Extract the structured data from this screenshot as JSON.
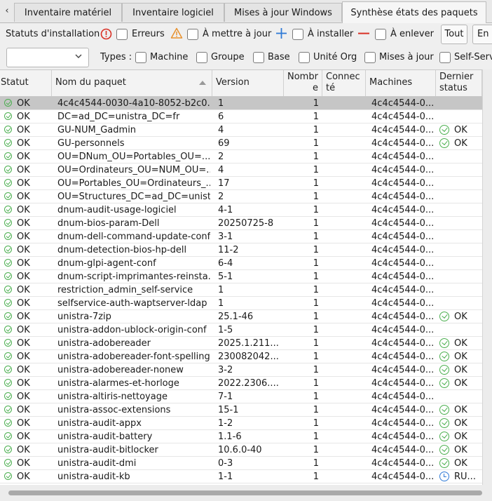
{
  "tabs": [
    {
      "label": "Inventaire matériel",
      "active": false
    },
    {
      "label": "Inventaire logiciel",
      "active": false
    },
    {
      "label": "Mises à jour Windows",
      "active": false
    },
    {
      "label": "Synthèse états des paquets",
      "active": true
    }
  ],
  "filters": {
    "status_label": "Statuts d'installation",
    "errors": "Erreurs",
    "to_update": "À mettre à jour",
    "to_install": "À installer",
    "to_remove": "À enlever",
    "all_button": "Tout",
    "cut_button": "En a",
    "types_label": "Types :",
    "types": [
      "Machine",
      "Groupe",
      "Base",
      "Unité Org",
      "Mises à jour",
      "Self-Serv"
    ],
    "combo_value": ""
  },
  "columns": {
    "status": "Statut",
    "package": "Nom du paquet",
    "version": "Version",
    "count_1": "Nombr",
    "count_2": "e",
    "connected_1": "Connec",
    "connected_2": "té",
    "machines": "Machines",
    "last_1": "Dernier",
    "last_2": "status"
  },
  "rows": [
    {
      "status": "OK",
      "name": "4c4c4544-0030-4a10-8052-b2c0...",
      "version": "1",
      "count": "1",
      "machines": "4c4c4544-0...",
      "last": ""
    },
    {
      "status": "OK",
      "name": "DC=ad_DC=unistra_DC=fr",
      "version": "6",
      "count": "1",
      "machines": "4c4c4544-0...",
      "last": ""
    },
    {
      "status": "OK",
      "name": "GU-NUM_Gadmin",
      "version": "4",
      "count": "1",
      "machines": "4c4c4544-0...",
      "last": "OK"
    },
    {
      "status": "OK",
      "name": "GU-personnels",
      "version": "69",
      "count": "1",
      "machines": "4c4c4544-0...",
      "last": "OK"
    },
    {
      "status": "OK",
      "name": "OU=DNum_OU=Portables_OU=...",
      "version": "2",
      "count": "1",
      "machines": "4c4c4544-0...",
      "last": ""
    },
    {
      "status": "OK",
      "name": "OU=Ordinateurs_OU=NUM_OU=...",
      "version": "4",
      "count": "1",
      "machines": "4c4c4544-0...",
      "last": ""
    },
    {
      "status": "OK",
      "name": "OU=Portables_OU=Ordinateurs_...",
      "version": "17",
      "count": "1",
      "machines": "4c4c4544-0...",
      "last": ""
    },
    {
      "status": "OK",
      "name": "OU=Structures_DC=ad_DC=unist...",
      "version": "2",
      "count": "1",
      "machines": "4c4c4544-0...",
      "last": ""
    },
    {
      "status": "OK",
      "name": "dnum-audit-usage-logiciel",
      "version": "4-1",
      "count": "1",
      "machines": "4c4c4544-0...",
      "last": ""
    },
    {
      "status": "OK",
      "name": "dnum-bios-param-Dell",
      "version": "20250725-8",
      "count": "1",
      "machines": "4c4c4544-0...",
      "last": ""
    },
    {
      "status": "OK",
      "name": "dnum-dell-command-update-conf",
      "version": "3-1",
      "count": "1",
      "machines": "4c4c4544-0...",
      "last": ""
    },
    {
      "status": "OK",
      "name": "dnum-detection-bios-hp-dell",
      "version": "11-2",
      "count": "1",
      "machines": "4c4c4544-0...",
      "last": ""
    },
    {
      "status": "OK",
      "name": "dnum-glpi-agent-conf",
      "version": "6-4",
      "count": "1",
      "machines": "4c4c4544-0...",
      "last": ""
    },
    {
      "status": "OK",
      "name": "dnum-script-imprimantes-reinsta...",
      "version": "5-1",
      "count": "1",
      "machines": "4c4c4544-0...",
      "last": ""
    },
    {
      "status": "OK",
      "name": "restriction_admin_self-service",
      "version": "1",
      "count": "1",
      "machines": "4c4c4544-0...",
      "last": ""
    },
    {
      "status": "OK",
      "name": "selfservice-auth-waptserver-ldap",
      "version": "1",
      "count": "1",
      "machines": "4c4c4544-0...",
      "last": ""
    },
    {
      "status": "OK",
      "name": "unistra-7zip",
      "version": "25.1-46",
      "count": "1",
      "machines": "4c4c4544-0...",
      "last": "OK"
    },
    {
      "status": "OK",
      "name": "unistra-addon-ublock-origin-conf",
      "version": "1-5",
      "count": "1",
      "machines": "4c4c4544-0...",
      "last": ""
    },
    {
      "status": "OK",
      "name": "unistra-adobereader",
      "version": "2025.1.211...",
      "count": "1",
      "machines": "4c4c4544-0...",
      "last": "OK"
    },
    {
      "status": "OK",
      "name": "unistra-adobereader-font-spelling",
      "version": "230082042...",
      "count": "1",
      "machines": "4c4c4544-0...",
      "last": "OK"
    },
    {
      "status": "OK",
      "name": "unistra-adobereader-nonew",
      "version": "3-2",
      "count": "1",
      "machines": "4c4c4544-0...",
      "last": "OK"
    },
    {
      "status": "OK",
      "name": "unistra-alarmes-et-horloge",
      "version": "2022.2306....",
      "count": "1",
      "machines": "4c4c4544-0...",
      "last": "OK"
    },
    {
      "status": "OK",
      "name": "unistra-altiris-nettoyage",
      "version": "7-1",
      "count": "1",
      "machines": "4c4c4544-0...",
      "last": ""
    },
    {
      "status": "OK",
      "name": "unistra-assoc-extensions",
      "version": "15-1",
      "count": "1",
      "machines": "4c4c4544-0...",
      "last": "OK"
    },
    {
      "status": "OK",
      "name": "unistra-audit-appx",
      "version": "1-2",
      "count": "1",
      "machines": "4c4c4544-0...",
      "last": "OK"
    },
    {
      "status": "OK",
      "name": "unistra-audit-battery",
      "version": "1.1-6",
      "count": "1",
      "machines": "4c4c4544-0...",
      "last": "OK"
    },
    {
      "status": "OK",
      "name": "unistra-audit-bitlocker",
      "version": "10.6.0-40",
      "count": "1",
      "machines": "4c4c4544-0...",
      "last": "OK"
    },
    {
      "status": "OK",
      "name": "unistra-audit-dmi",
      "version": "0-3",
      "count": "1",
      "machines": "4c4c4544-0...",
      "last": "OK"
    },
    {
      "status": "OK",
      "name": "unistra-audit-kb",
      "version": "1-1",
      "count": "1",
      "machines": "4c4c4544-0...",
      "last": "RU..."
    }
  ],
  "colors": {
    "ok": "#4caf50",
    "error": "#d93025",
    "warning": "#e8912d",
    "add": "#2f7ad6",
    "remove": "#d93025",
    "selected": "#c6c6c6"
  },
  "icons": {
    "errors": "error-circle-icon",
    "to_update": "warning-triangle-icon",
    "to_install": "plus-icon",
    "to_remove": "minus-icon",
    "ok": "check-circle-icon",
    "running": "clock-icon"
  }
}
